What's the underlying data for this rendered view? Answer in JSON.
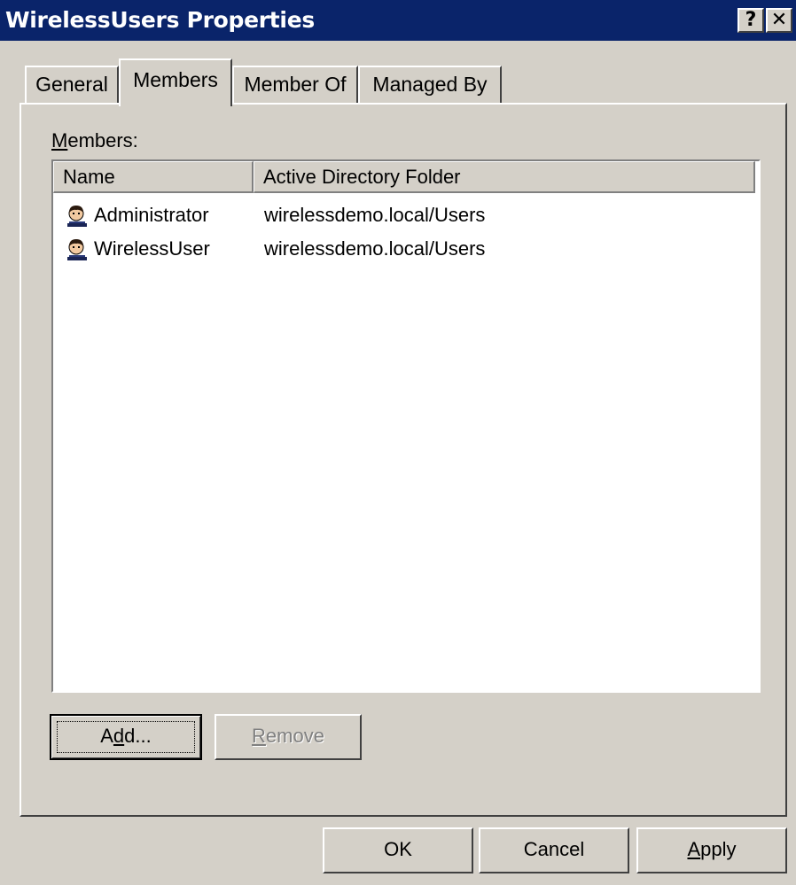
{
  "window": {
    "title": "WirelessUsers Properties",
    "help_glyph": "?",
    "close_glyph": "✕"
  },
  "tabs": [
    {
      "label": "General",
      "active": false
    },
    {
      "label": "Members",
      "active": true
    },
    {
      "label": "Member Of",
      "active": false
    },
    {
      "label": "Managed By",
      "active": false
    }
  ],
  "members": {
    "label_mnemonic": "M",
    "label_rest": "embers:",
    "columns": [
      "Name",
      "Active Directory Folder"
    ],
    "rows": [
      {
        "icon": "user-icon",
        "name": "Administrator",
        "folder": "wirelessdemo.local/Users"
      },
      {
        "icon": "user-icon",
        "name": "WirelessUser",
        "folder": "wirelessdemo.local/Users"
      }
    ]
  },
  "buttons": {
    "add_pre": "A",
    "add_mnemonic": "d",
    "add_post": "d...",
    "remove_mnemonic": "R",
    "remove_post": "emove",
    "ok": "OK",
    "cancel": "Cancel",
    "apply_mnemonic": "A",
    "apply_post": "pply"
  },
  "colors": {
    "titlebar": "#0a246a",
    "face": "#d4d0c8",
    "disabled_text": "#808080"
  }
}
